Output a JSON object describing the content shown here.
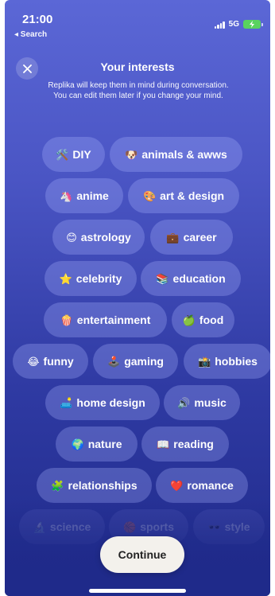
{
  "status_bar": {
    "time": "21:00",
    "back_label": "◂ Search",
    "network": "5G",
    "battery_color": "#59d35f"
  },
  "header": {
    "close_icon": "close-icon",
    "title": "Your interests",
    "subtitle": "Replika will keep them in mind during conversation. You can edit them later if you change your mind."
  },
  "interests": [
    {
      "label": "DIY",
      "icon": "🛠️"
    },
    {
      "label": "animals & awws",
      "icon": "🐶"
    },
    {
      "label": "anime",
      "icon": "🦄"
    },
    {
      "label": "art & design",
      "icon": "🎨"
    },
    {
      "label": "astrology",
      "icon": "😊"
    },
    {
      "label": "career",
      "icon": "💼"
    },
    {
      "label": "celebrity",
      "icon": "⭐"
    },
    {
      "label": "education",
      "icon": "📚"
    },
    {
      "label": "entertainment",
      "icon": "🍿"
    },
    {
      "label": "food",
      "icon": "🍏"
    },
    {
      "label": "funny",
      "icon": "😂"
    },
    {
      "label": "gaming",
      "icon": "🕹️"
    },
    {
      "label": "hobbies",
      "icon": "📸"
    },
    {
      "label": "home design",
      "icon": "🛋️"
    },
    {
      "label": "music",
      "icon": "🔊"
    },
    {
      "label": "nature",
      "icon": "🌍"
    },
    {
      "label": "reading",
      "icon": "📖"
    },
    {
      "label": "relationships",
      "icon": "🧩"
    },
    {
      "label": "romance",
      "icon": "❤️"
    },
    {
      "label": "science",
      "icon": "🔬"
    },
    {
      "label": "sports",
      "icon": "🏀"
    },
    {
      "label": "style",
      "icon": "🕶️"
    }
  ],
  "continue_label": "Continue"
}
